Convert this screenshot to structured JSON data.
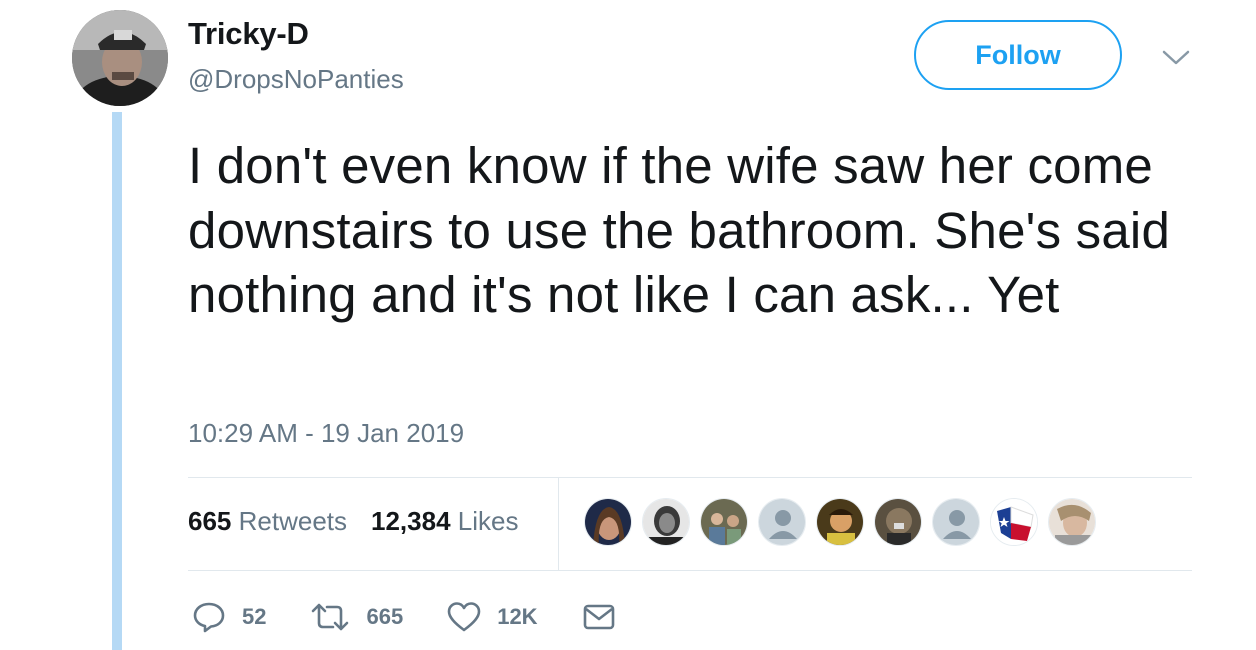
{
  "user": {
    "display_name": "Tricky-D",
    "handle": "@DropsNoPanties",
    "avatar_icon": "user-avatar"
  },
  "header": {
    "follow_label": "Follow",
    "menu_icon": "chevron-down-icon"
  },
  "tweet": {
    "text": "I don't even know if the wife saw her come downstairs to use the bathroom. She's said nothing and it's not like I can ask... Yet",
    "timestamp": "10:29 AM - 19 Jan 2019"
  },
  "stats": {
    "retweets_count": "665",
    "retweets_label": "Retweets",
    "likes_count": "12,384",
    "likes_label": "Likes"
  },
  "likers": [
    "liker-avatar",
    "liker-avatar",
    "liker-avatar",
    "default-avatar",
    "liker-avatar",
    "liker-avatar",
    "default-avatar",
    "texas-flag-avatar",
    "liker-avatar"
  ],
  "actions": {
    "reply_count": "52",
    "retweet_count": "665",
    "like_count": "12K",
    "message_icon": "envelope-icon"
  },
  "colors": {
    "accent": "#1da1f2",
    "thread_line": "#b5d9f5",
    "muted": "#657786",
    "text": "#14171a"
  }
}
